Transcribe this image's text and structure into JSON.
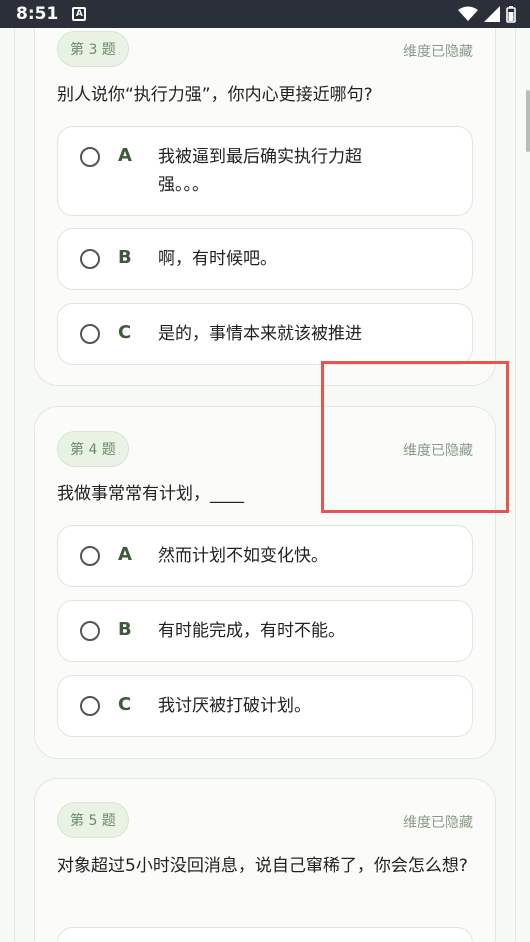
{
  "status_bar": {
    "time": "8:51",
    "notification_glyph": "A"
  },
  "questions": [
    {
      "tag": "第 3 题",
      "dimension": "维度已隐藏",
      "text": "别人说你“执行力强”，你内心更接近哪句?",
      "options": [
        {
          "letter": "A",
          "text": "我被逼到最后确实执行力超强。。。"
        },
        {
          "letter": "B",
          "text": "啊，有时候吧。"
        },
        {
          "letter": "C",
          "text": "是的，事情本来就该被推进"
        }
      ]
    },
    {
      "tag": "第 4 题",
      "dimension": "维度已隐藏",
      "text": "我做事常常有计划，____",
      "options": [
        {
          "letter": "A",
          "text": "然而计划不如变化快。"
        },
        {
          "letter": "B",
          "text": "有时能完成，有时不能。"
        },
        {
          "letter": "C",
          "text": "我讨厌被打破计划。"
        }
      ]
    },
    {
      "tag": "第 5 题",
      "dimension": "维度已隐藏",
      "text": "对象超过5小时没回消息，说自己窜稀了，你会怎么想?"
    }
  ]
}
